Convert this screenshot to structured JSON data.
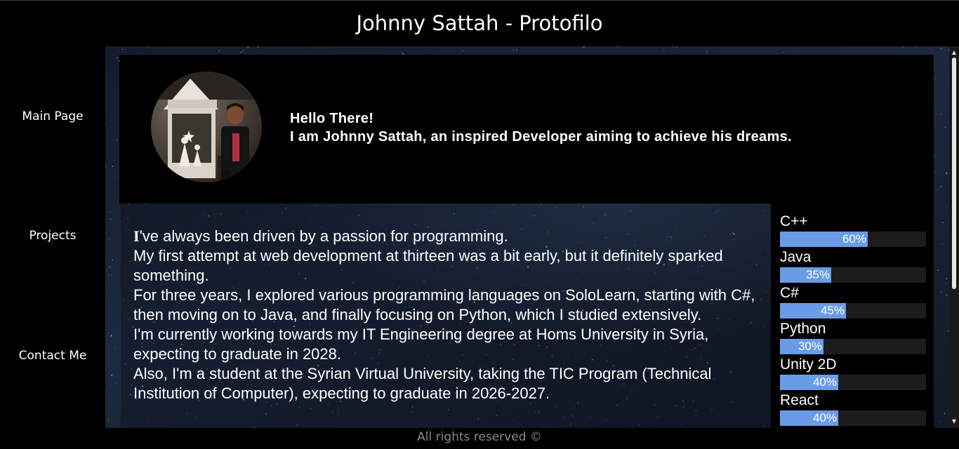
{
  "header": {
    "title": "Johnny Sattah - Protofilo"
  },
  "nav": {
    "items": [
      {
        "label": "Main Page"
      },
      {
        "label": "Projects"
      },
      {
        "label": "Contact Me"
      }
    ]
  },
  "intro": {
    "avatar_icon": "profile-photo",
    "greeting_line1": "Hello There!",
    "greeting_line2": "I am Johnny Sattah, an inspired Developer aiming to achieve his dreams."
  },
  "about": {
    "dropcap": "I",
    "p1_rest": "'ve always been driven by a passion for programming.",
    "p2": "My first attempt at web development at thirteen was a bit early, but it definitely sparked something.",
    "p3": "For three years, I explored various programming languages on SoloLearn, starting with C#, then moving on to Java, and finally focusing on Python, which I studied extensively.",
    "p4": "I'm currently working towards my IT Engineering degree at Homs University in Syria, expecting to graduate in 2028.",
    "p5": "Also, I'm a student at the Syrian Virtual University, taking the TIC Program (Technical Institution of Computer), expecting to graduate in 2026-2027."
  },
  "skills": [
    {
      "name": "C++",
      "percent_label": "60%",
      "level": 0.6
    },
    {
      "name": "Java",
      "percent_label": "35%",
      "level": 0.35
    },
    {
      "name": "C#",
      "percent_label": "45%",
      "level": 0.45
    },
    {
      "name": "Python",
      "percent_label": "30%",
      "level": 0.3
    },
    {
      "name": "Unity 2D",
      "percent_label": "40%",
      "level": 0.4
    },
    {
      "name": "React",
      "percent_label": "40%",
      "level": 0.4
    }
  ],
  "colors": {
    "skill_fill": "#6a9be6",
    "skill_track": "#1c1c1c",
    "footer_text": "#8a8a8a"
  },
  "footer": {
    "text": "All rights reserved ©"
  }
}
